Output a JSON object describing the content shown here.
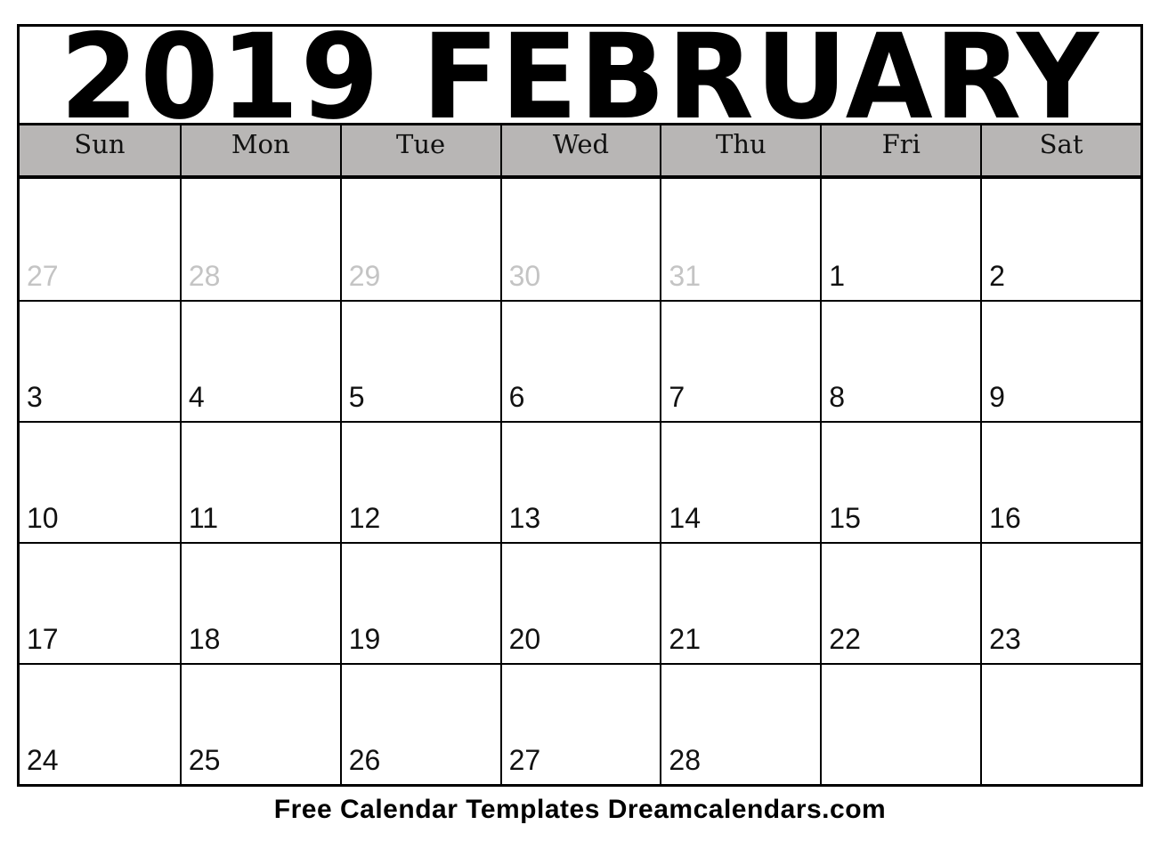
{
  "title": {
    "year": "2019",
    "month": "FEBRUARY"
  },
  "weekdays": [
    "Sun",
    "Mon",
    "Tue",
    "Wed",
    "Thu",
    "Fri",
    "Sat"
  ],
  "weeks": [
    [
      {
        "day": "27",
        "other_month": true
      },
      {
        "day": "28",
        "other_month": true
      },
      {
        "day": "29",
        "other_month": true
      },
      {
        "day": "30",
        "other_month": true
      },
      {
        "day": "31",
        "other_month": true
      },
      {
        "day": "1"
      },
      {
        "day": "2"
      }
    ],
    [
      {
        "day": "3"
      },
      {
        "day": "4"
      },
      {
        "day": "5"
      },
      {
        "day": "6"
      },
      {
        "day": "7"
      },
      {
        "day": "8"
      },
      {
        "day": "9"
      }
    ],
    [
      {
        "day": "10"
      },
      {
        "day": "11"
      },
      {
        "day": "12"
      },
      {
        "day": "13"
      },
      {
        "day": "14"
      },
      {
        "day": "15"
      },
      {
        "day": "16"
      }
    ],
    [
      {
        "day": "17"
      },
      {
        "day": "18"
      },
      {
        "day": "19"
      },
      {
        "day": "20"
      },
      {
        "day": "21"
      },
      {
        "day": "22"
      },
      {
        "day": "23"
      }
    ],
    [
      {
        "day": "24"
      },
      {
        "day": "25"
      },
      {
        "day": "26"
      },
      {
        "day": "27"
      },
      {
        "day": "28"
      },
      {
        "day": ""
      },
      {
        "day": ""
      }
    ]
  ],
  "footer": "Free Calendar Templates Dreamcalendars.com",
  "colors": {
    "header_bg": "#b8b6b5",
    "other_month_text": "#c4c4c4",
    "border": "#000000"
  }
}
